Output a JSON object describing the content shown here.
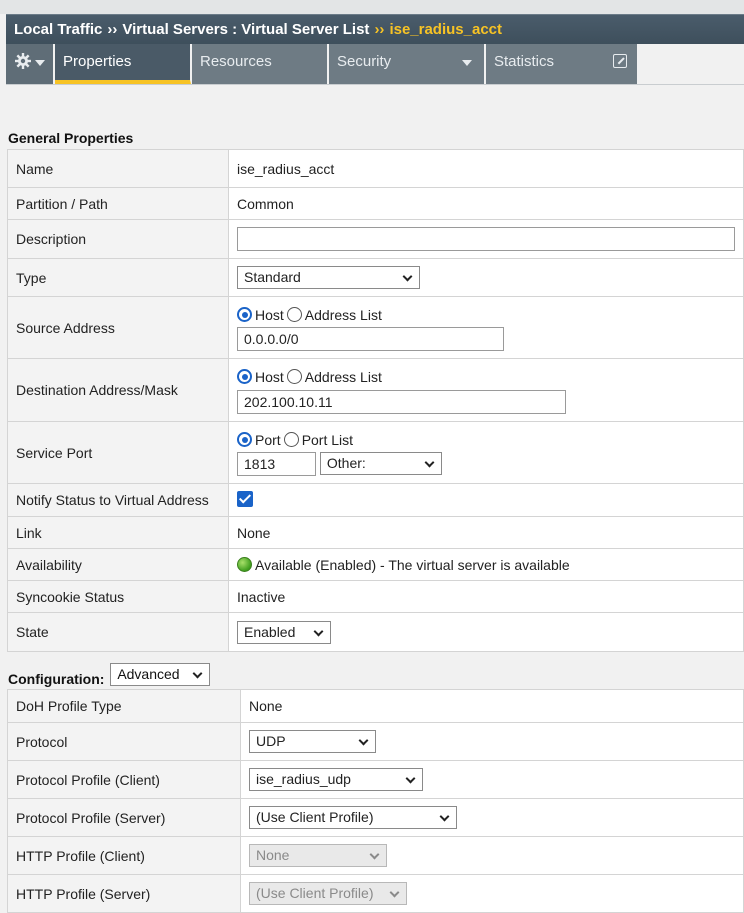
{
  "breadcrumb": {
    "part1": "Local Traffic",
    "sep1": "››",
    "part2": "Virtual Servers : Virtual Server List",
    "sep2": "››",
    "current": "ise_radius_acct"
  },
  "tabs": {
    "gear_icon": "gear-icon",
    "properties": "Properties",
    "resources": "Resources",
    "security": "Security",
    "statistics": "Statistics"
  },
  "general": {
    "title": "General Properties",
    "name_label": "Name",
    "name_value": "ise_radius_acct",
    "partition_label": "Partition / Path",
    "partition_value": "Common",
    "description_label": "Description",
    "description_value": "",
    "type_label": "Type",
    "type_value": "Standard",
    "source_label": "Source Address",
    "source_opt_host": "Host",
    "source_opt_list": "Address List",
    "source_value": "0.0.0.0/0",
    "dest_label": "Destination Address/Mask",
    "dest_opt_host": "Host",
    "dest_opt_list": "Address List",
    "dest_value": "202.100.10.11",
    "port_label": "Service Port",
    "port_opt_port": "Port",
    "port_opt_list": "Port List",
    "port_value": "1813",
    "port_select": "Other:",
    "notify_label": "Notify Status to Virtual Address",
    "link_label": "Link",
    "link_value": "None",
    "availability_label": "Availability",
    "availability_value": "Available (Enabled) - The virtual server is available",
    "syncookie_label": "Syncookie Status",
    "syncookie_value": "Inactive",
    "state_label": "State",
    "state_value": "Enabled"
  },
  "configuration": {
    "title": "Configuration:",
    "mode": "Advanced",
    "doh_label": "DoH Profile Type",
    "doh_value": "None",
    "protocol_label": "Protocol",
    "protocol_value": "UDP",
    "ppc_label": "Protocol Profile (Client)",
    "ppc_value": "ise_radius_udp",
    "pps_label": "Protocol Profile (Server)",
    "pps_value": "(Use Client Profile)",
    "hpc_label": "HTTP Profile (Client)",
    "hpc_value": "None",
    "hps_label": "HTTP Profile (Server)",
    "hps_value": "(Use Client Profile)"
  },
  "colors": {
    "header_bg": "#3e4f5c",
    "accent_gold": "#f7c325",
    "highlight_yellow": "#f7f700",
    "control_blue": "#1a63c8",
    "status_green": "#3f9e1e"
  }
}
